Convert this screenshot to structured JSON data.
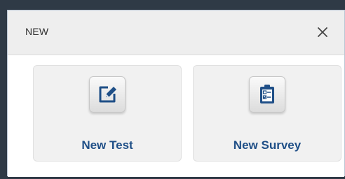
{
  "dialog": {
    "title": "NEW",
    "close_icon": "close-icon"
  },
  "options": [
    {
      "label": "New Test",
      "icon": "edit-pencil-icon"
    },
    {
      "label": "New Survey",
      "icon": "clipboard-checklist-icon"
    }
  ],
  "colors": {
    "label_text": "#1f4f87",
    "icon_accent": "#1f4f87",
    "header_bg": "#eeeeee",
    "card_bg": "#f1f1f1"
  }
}
